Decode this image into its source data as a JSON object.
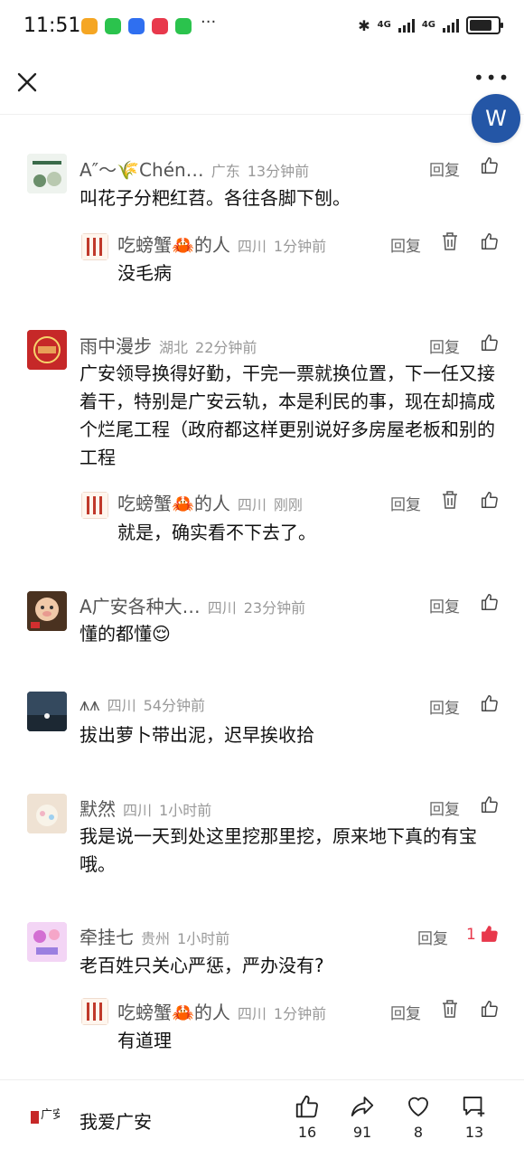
{
  "status": {
    "time": "11:51",
    "net1": "4G",
    "net2": "4G",
    "app_icons": [
      {
        "name": "weibo-icon",
        "color": "#f5a623"
      },
      {
        "name": "wechat-icon",
        "color": "#2bc34d"
      },
      {
        "name": "voice-app-icon",
        "color": "#2f6ff0"
      },
      {
        "name": "heart-app-icon",
        "color": "#e8394c"
      },
      {
        "name": "wechat-icon-2",
        "color": "#2bc34d"
      }
    ],
    "more": "···"
  },
  "header": {
    "avatar_letter": "W",
    "more": "•••"
  },
  "comments": [
    {
      "name": "A″〜🌾Chén…",
      "region": "广东",
      "time": "13分钟前",
      "text": "叫花子分粑红苕。各往各脚下刨。",
      "reply_label": "回复",
      "replies": [
        {
          "name": "吃螃蟹🦀的人",
          "region": "四川",
          "time": "1分钟前",
          "text": "没毛病",
          "reply_label": "回复"
        }
      ]
    },
    {
      "name": "雨中漫步",
      "region": "湖北",
      "time": "22分钟前",
      "text": "广安领导换得好勤，干完一票就换位置，下一任又接着干，特别是广安云轨，本是利民的事，现在却搞成个烂尾工程（政府都这样更别说好多房屋老板和别的工程",
      "reply_label": "回复",
      "replies": [
        {
          "name": "吃螃蟹🦀的人",
          "region": "四川",
          "time": "刚刚",
          "text": "就是，确实看不下去了。",
          "reply_label": "回复"
        }
      ]
    },
    {
      "name": "A广安各种大…",
      "region": "四川",
      "time": "23分钟前",
      "text": "懂的都懂😌",
      "reply_label": "回复",
      "replies": []
    },
    {
      "name": "⩚⩚",
      "region": "四川",
      "time": "54分钟前",
      "text": "拔出萝卜带出泥，迟早挨收拾",
      "reply_label": "回复",
      "replies": []
    },
    {
      "name": "默然",
      "region": "四川",
      "time": "1小时前",
      "text": "我是说一天到处这里挖那里挖，原来地下真的有宝哦。",
      "reply_label": "回复",
      "replies": []
    },
    {
      "name": "牵挂七",
      "region": "贵州",
      "time": "1小时前",
      "text": "老百姓只关心严惩，严办没有?",
      "reply_label": "回复",
      "likes": "1",
      "replies": [
        {
          "name": "吃螃蟹🦀的人",
          "region": "四川",
          "time": "1分钟前",
          "text": "有道理",
          "reply_label": "回复"
        }
      ]
    }
  ],
  "bottom": {
    "title": "我爱广安",
    "logo_text": "广安",
    "like_count": "16",
    "share_count": "91",
    "favorite_count": "8",
    "comment_count": "13"
  },
  "colors": {
    "accent_red": "#e8394c",
    "avatar_blue": "#2456a6"
  }
}
